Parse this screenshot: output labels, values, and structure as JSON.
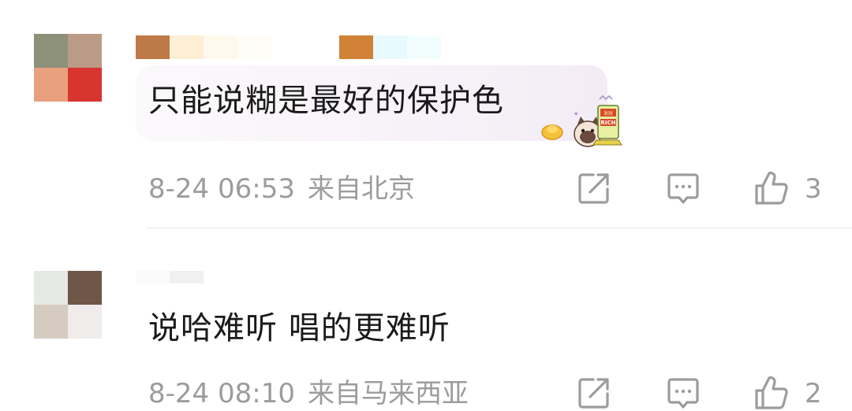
{
  "comments": [
    {
      "text": "只能说糊是最好的保护色",
      "time": "8-24 06:53",
      "location": "来自北京",
      "likes": "3",
      "sticker": {
        "text": "RICH",
        "label": "发财"
      },
      "avatar_colors": [
        "#8e9179",
        "#bb9a87",
        "#e8a07f",
        "#d7352e"
      ],
      "name_colors_a": [
        "#bd7a48",
        "#fdeed6",
        "#fef9ec",
        "#fffdf6"
      ],
      "name_colors_b": [
        "#cf8235",
        "#e8fafd",
        "#f2fdfe"
      ]
    },
    {
      "text": "说哈难听 唱的更难听",
      "time": "8-24 08:10",
      "location": "来自马来西亚",
      "likes": "2",
      "avatar_colors": [
        "#e6e8e4",
        "#6e5748",
        "#d5cbc0",
        "#f1ecec"
      ],
      "name_colors_a": [
        "#fbfbfb",
        "#f0f0f0"
      ]
    }
  ],
  "icons": [
    "share-icon",
    "comment-icon",
    "like-icon"
  ]
}
